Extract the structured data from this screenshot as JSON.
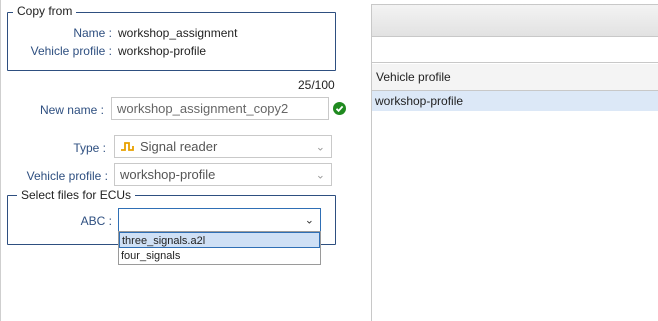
{
  "copy_from": {
    "legend": "Copy from",
    "name_label": "Name :",
    "name_value": "workshop_assignment",
    "profile_label": "Vehicle profile :",
    "profile_value": "workshop-profile"
  },
  "new_name": {
    "counter": "25/100",
    "label": "New name :",
    "value": "workshop_assignment_copy2"
  },
  "type": {
    "label": "Type :",
    "value": "Signal reader",
    "icon": "signal-reader-icon"
  },
  "vehicle_profile": {
    "label": "Vehicle profile :",
    "value": "workshop-profile"
  },
  "select_files": {
    "legend": "Select files for ECUs",
    "ecu_label": "ABC :",
    "ecu_value": "",
    "options": [
      "three_signals.a2l",
      "four_signals"
    ]
  },
  "right_table": {
    "column_header": "Vehicle profile",
    "rows": [
      "workshop-profile"
    ]
  },
  "colors": {
    "label_blue": "#2e4f80",
    "valid_green": "#1f8a1f",
    "selected_row": "#dce8f7",
    "accent_orange": "#e8a000"
  }
}
